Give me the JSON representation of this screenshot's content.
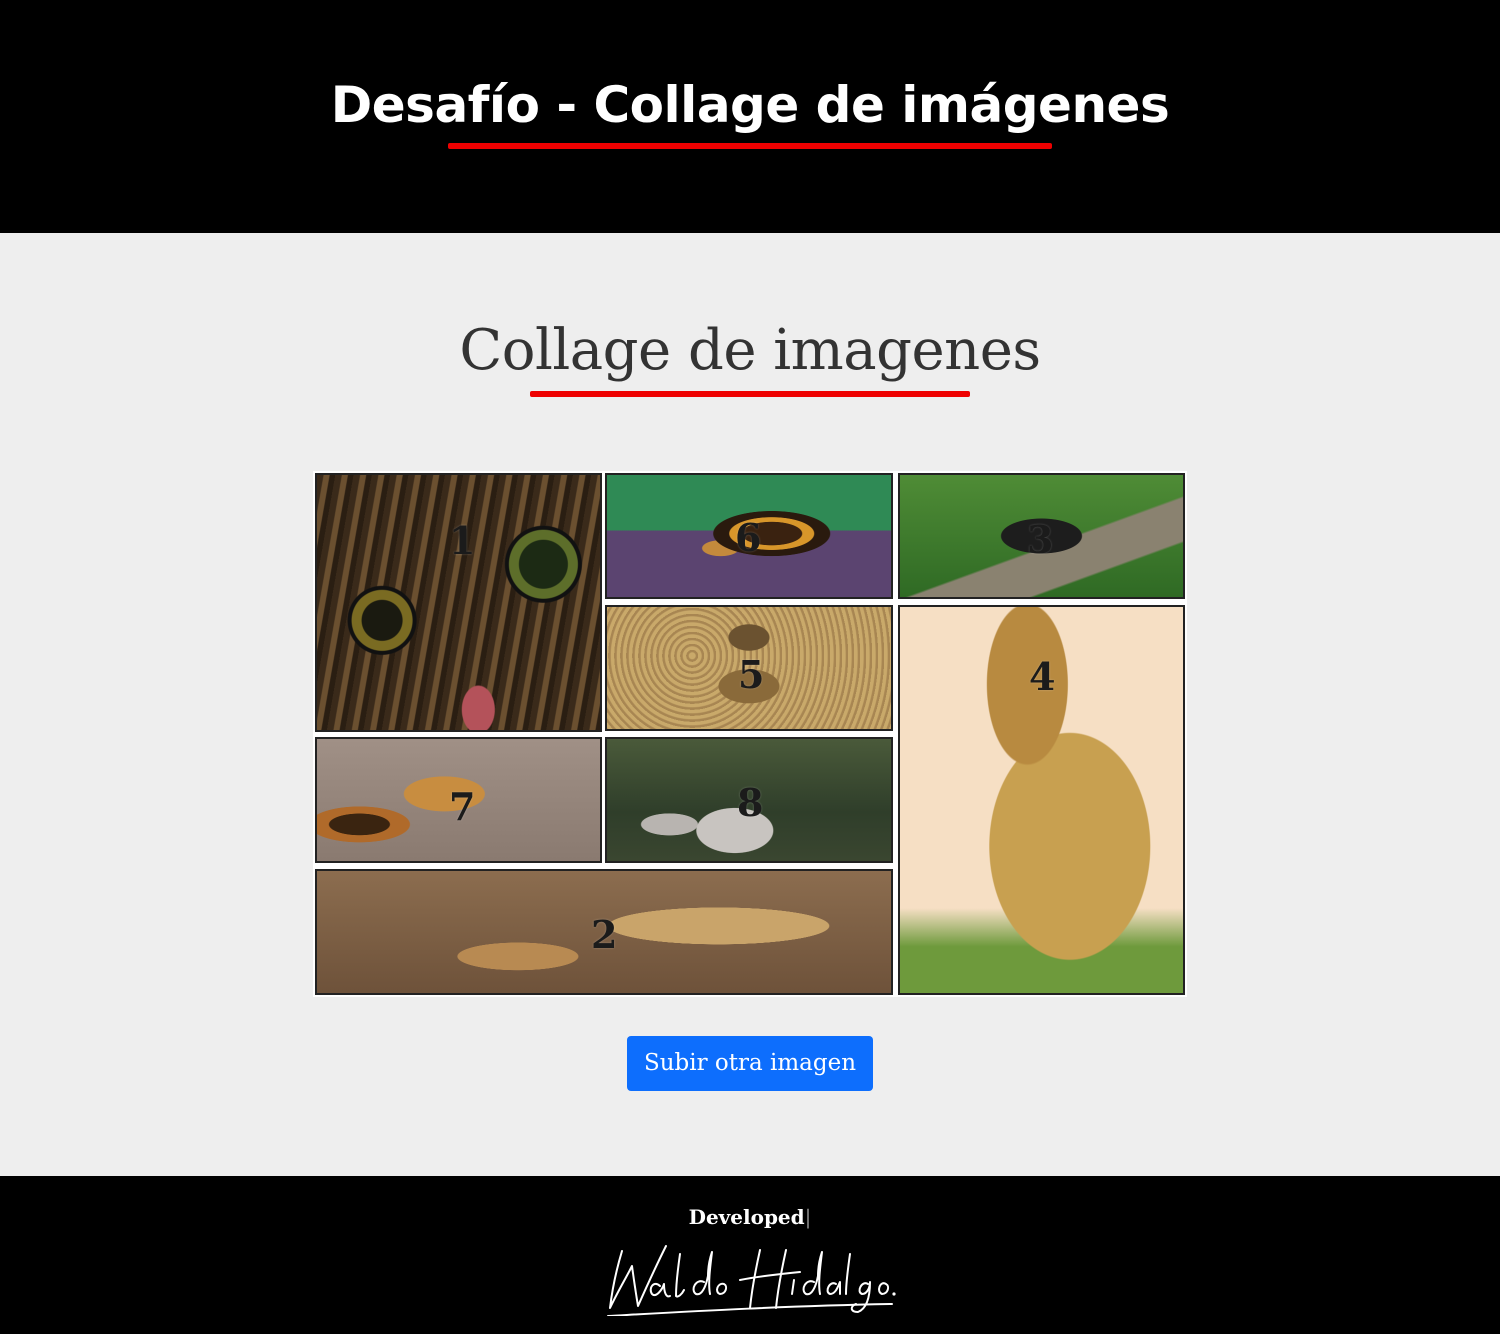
{
  "header": {
    "title": "Desafío - Collage de imágenes",
    "underline_color": "#ee0000",
    "background": "#000000"
  },
  "main": {
    "section_title": "Collage de imagenes",
    "underline_color": "#ee0000",
    "collage": {
      "tiles": [
        {
          "number": "1",
          "subject": "tabby cat close-up"
        },
        {
          "number": "6",
          "subject": "tortoise"
        },
        {
          "number": "3",
          "subject": "grasshopper"
        },
        {
          "number": "5",
          "subject": "meerkat"
        },
        {
          "number": "4",
          "subject": "cheetah"
        },
        {
          "number": "7",
          "subject": "calico cat"
        },
        {
          "number": "8",
          "subject": "squirrel"
        },
        {
          "number": "2",
          "subject": "rodent paws"
        }
      ]
    },
    "upload_button": "Subir otra imagen",
    "button_color": "#0d6efd"
  },
  "footer": {
    "developed_label": "Developed",
    "separator": "|",
    "signature": "Waldo Hidalgo."
  }
}
